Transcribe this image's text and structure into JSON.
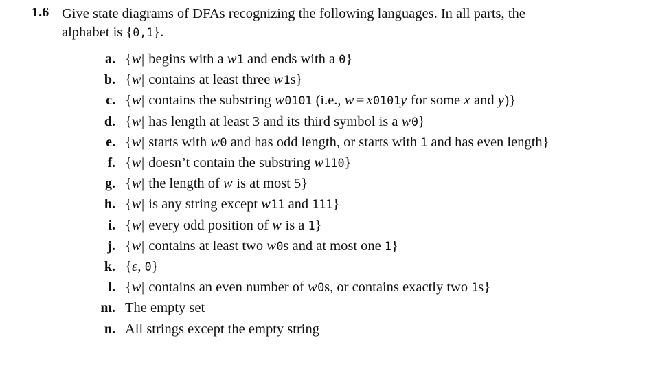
{
  "exercise": {
    "number": "1.6",
    "prompt": "Give state diagrams of DFAs recognizing the following languages. In all parts, the alphabet is {0,1}.",
    "prompt_line1": "Give state diagrams of DFAs recognizing the following languages. In all parts, the",
    "prompt_line2_prefix": "alphabet is {",
    "prompt_alphabet": "0,1",
    "prompt_line2_suffix": "}."
  },
  "parts": [
    {
      "label": "a.",
      "text": "{w| w begins with a 1 and ends with a 0}",
      "open": "{",
      "var": "w",
      "bar": "|",
      "var2": "w",
      "seg1": " begins with a ",
      "sym1": "1",
      "seg2": " and ends with a ",
      "sym2": "0",
      "close": "}"
    },
    {
      "label": "b.",
      "text": "{w| w contains at least three 1s}",
      "open": "{",
      "var": "w",
      "bar": "|",
      "var2": "w",
      "seg1": " contains at least three ",
      "sym1": "1",
      "seg2": "s",
      "close": "}"
    },
    {
      "label": "c.",
      "text": "{w| w contains the substring 0101 (i.e., w = x0101y for some x and y)}",
      "open": "{",
      "var": "w",
      "bar": "|",
      "var2": "w",
      "seg1": " contains the substring ",
      "sym1": "0101",
      "seg2": " (i.e., ",
      "var3": "w",
      "eq": "=",
      "var4": "x",
      "sym2": "0101",
      "var5": "y",
      "seg3": " for some ",
      "var6": "x",
      "seg4": " and ",
      "var7": "y",
      "seg5": ")",
      "close": "}"
    },
    {
      "label": "d.",
      "text": "{w| w has length at least 3 and its third symbol is a 0}",
      "open": "{",
      "var": "w",
      "bar": "|",
      "var2": "w",
      "seg1": " has length at least 3 and its third symbol is a ",
      "sym1": "0",
      "close": "}"
    },
    {
      "label": "e.",
      "text": "{w| w starts with 0 and has odd length, or starts with 1 and has even length}",
      "open": "{",
      "var": "w",
      "bar": "|",
      "var2": "w",
      "seg1": " starts with ",
      "sym1": "0",
      "seg2": " and has odd length, or starts with ",
      "sym2": "1",
      "seg3": " and has even length",
      "close": "}"
    },
    {
      "label": "f.",
      "text": "{w| w doesn’t contain the substring 110}",
      "open": "{",
      "var": "w",
      "bar": "|",
      "var2": "w",
      "seg1": " doesn’t contain the substring ",
      "sym1": "110",
      "close": "}"
    },
    {
      "label": "g.",
      "text": "{w| the length of w is at most 5}",
      "open": "{",
      "var": "w",
      "bar": "|",
      "seg1": " the length of ",
      "var2": "w",
      "seg2": " is at most 5",
      "close": "}"
    },
    {
      "label": "h.",
      "text": "{w| w is any string except 11 and 111}",
      "open": "{",
      "var": "w",
      "bar": "|",
      "var2": "w",
      "seg1": " is any string except ",
      "sym1": "11",
      "seg2": " and ",
      "sym2": "111",
      "close": "}"
    },
    {
      "label": "i.",
      "text": "{w| every odd position of w is a 1}",
      "open": "{",
      "var": "w",
      "bar": "|",
      "seg1": " every odd position of ",
      "var2": "w",
      "seg2": " is a ",
      "sym1": "1",
      "close": "}"
    },
    {
      "label": "j.",
      "text": "{w| w contains at least two 0s and at most one 1}",
      "open": "{",
      "var": "w",
      "bar": "|",
      "var2": "w",
      "seg1": " contains at least two ",
      "sym1": "0",
      "seg2": "s and at most one ",
      "sym2": "1",
      "close": "}"
    },
    {
      "label": "k.",
      "text": "{ε, 0}",
      "open": "{",
      "var": "ε",
      "seg1": ", ",
      "sym1": "0",
      "close": "}"
    },
    {
      "label": "l.",
      "text": "{w| w contains an even number of 0s, or contains exactly two 1s}",
      "open": "{",
      "var": "w",
      "bar": "|",
      "var2": "w",
      "seg1": " contains an even number of ",
      "sym1": "0",
      "seg2": "s, or contains exactly two ",
      "sym2": "1",
      "seg3": "s",
      "close": "}"
    },
    {
      "label": "m.",
      "text": "The empty set",
      "plain": "The empty set"
    },
    {
      "label": "n.",
      "text": "All strings except the empty string",
      "plain": "All strings except the empty string"
    }
  ]
}
